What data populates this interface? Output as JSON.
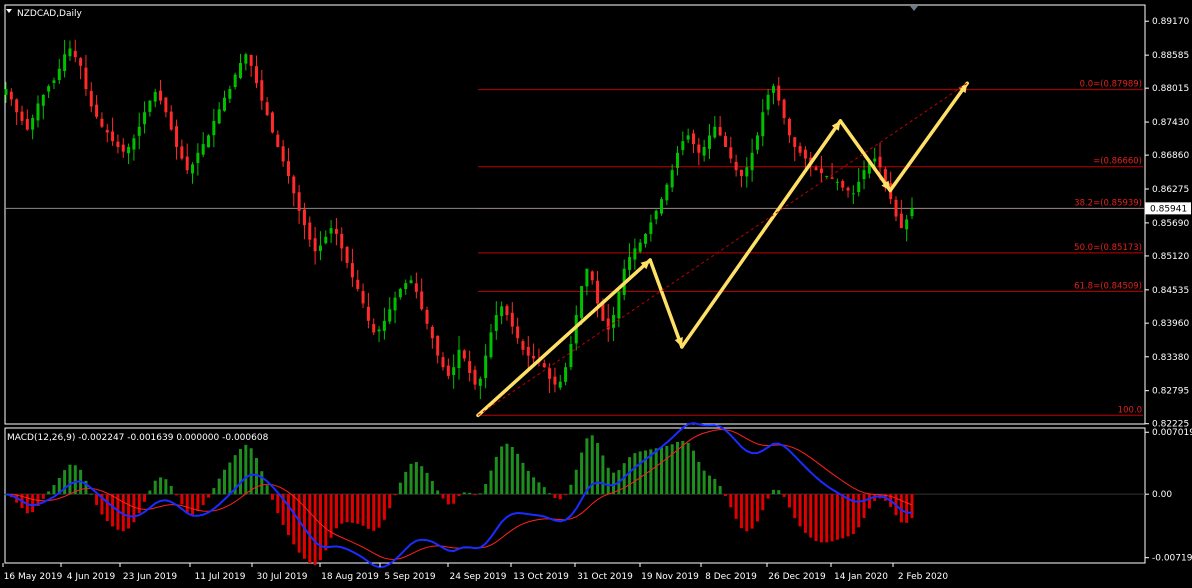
{
  "window": {
    "symbol_title": "NZDCAD,Daily",
    "current_price": "0.85941",
    "colors": {
      "bull": "#00c000",
      "bear": "#ff2a2a",
      "fib": "#c00000",
      "arrow": "#ffe066",
      "macd_line": "#1a2cff",
      "signal_line": "#ff2020",
      "hist_pos": "#1e8f1e",
      "hist_neg": "#e00000",
      "grid_frame": "#ffffff"
    }
  },
  "chart_data": [
    {
      "type": "candlestick",
      "title": "NZDCAD,Daily",
      "y_ticks": [
        "0.89170",
        "0.88585",
        "0.88015",
        "0.87430",
        "0.86860",
        "0.86275",
        "0.85690",
        "0.85120",
        "0.84535",
        "0.83960",
        "0.83380",
        "0.82795",
        "0.82225"
      ],
      "ylim": [
        0.8222,
        0.8945
      ],
      "x_ticks": [
        "16 May 2019",
        "4 Jun 2019",
        "23 Jun 2019",
        "11 Jul 2019",
        "30 Jul 2019",
        "18 Aug 2019",
        "5 Sep 2019",
        "24 Sep 2019",
        "13 Oct 2019",
        "31 Oct 2019",
        "19 Nov 2019",
        "8 Dec 2019",
        "26 Dec 2019",
        "14 Jan 2020",
        "2 Feb 2020"
      ],
      "fibonacci_levels": [
        {
          "label": "0.0=(0.87989)",
          "value": 0.87989
        },
        {
          "label": "=(0.86660)",
          "value": 0.8666
        },
        {
          "label": "38.2=(0.85939)",
          "value": 0.85939
        },
        {
          "label": "50.0=(0.85173)",
          "value": 0.85173
        },
        {
          "label": "61.8=(0.84509)",
          "value": 0.84509
        },
        {
          "label": "100.0",
          "value": 0.8237
        }
      ],
      "trend_path": [
        {
          "bar": 0.0,
          "price": 0.8237
        },
        {
          "bar": 0.19,
          "price": 0.8505
        },
        {
          "bar": 0.225,
          "price": 0.8355
        },
        {
          "bar": 0.4,
          "price": 0.8745
        },
        {
          "bar": 0.455,
          "price": 0.8625
        },
        {
          "bar": 0.54,
          "price": 0.881
        }
      ],
      "closes": [
        0.88,
        0.8782,
        0.876,
        0.8745,
        0.873,
        0.875,
        0.8775,
        0.879,
        0.8805,
        0.8815,
        0.8835,
        0.886,
        0.887,
        0.8855,
        0.884,
        0.88,
        0.877,
        0.8752,
        0.8735,
        0.8725,
        0.871,
        0.87,
        0.8692,
        0.87,
        0.8715,
        0.8735,
        0.876,
        0.878,
        0.8795,
        0.878,
        0.876,
        0.873,
        0.87,
        0.868,
        0.866,
        0.867,
        0.869,
        0.8705,
        0.872,
        0.8745,
        0.8765,
        0.8785,
        0.88,
        0.8825,
        0.8845,
        0.886,
        0.884,
        0.881,
        0.878,
        0.8755,
        0.8725,
        0.87,
        0.8675,
        0.865,
        0.862,
        0.859,
        0.8565,
        0.854,
        0.852,
        0.853,
        0.8545,
        0.856,
        0.855,
        0.8525,
        0.85,
        0.8475,
        0.8455,
        0.843,
        0.84,
        0.838,
        0.8385,
        0.84,
        0.842,
        0.844,
        0.8455,
        0.8465,
        0.847,
        0.845,
        0.842,
        0.8395,
        0.837,
        0.834,
        0.832,
        0.8305,
        0.832,
        0.835,
        0.8335,
        0.831,
        0.829,
        0.83,
        0.834,
        0.838,
        0.841,
        0.8425,
        0.841,
        0.839,
        0.837,
        0.835,
        0.834,
        0.8335,
        0.833,
        0.832,
        0.83,
        0.829,
        0.8295,
        0.832,
        0.836,
        0.841,
        0.846,
        0.849,
        0.847,
        0.843,
        0.84,
        0.8385,
        0.841,
        0.845,
        0.849,
        0.851,
        0.8525,
        0.8535,
        0.855,
        0.857,
        0.859,
        0.861,
        0.8635,
        0.866,
        0.869,
        0.871,
        0.872,
        0.8705,
        0.869,
        0.87,
        0.872,
        0.8735,
        0.872,
        0.87,
        0.868,
        0.866,
        0.865,
        0.8665,
        0.869,
        0.872,
        0.876,
        0.879,
        0.8805,
        0.878,
        0.875,
        0.872,
        0.87,
        0.869,
        0.868,
        0.867,
        0.866,
        0.8655,
        0.865,
        0.8645,
        0.864,
        0.863,
        0.8625,
        0.862,
        0.864,
        0.866,
        0.8675,
        0.868,
        0.8665,
        0.864,
        0.861,
        0.858,
        0.856,
        0.8575,
        0.8594
      ]
    },
    {
      "type": "macd",
      "title": "MACD(12,26,9) -0.002247 -0.001639 0.000000 -0.000608",
      "y_ticks": [
        "0.007019",
        "0.00",
        "-0.007195"
      ],
      "ylim": [
        -0.0078,
        0.0075
      ]
    }
  ]
}
